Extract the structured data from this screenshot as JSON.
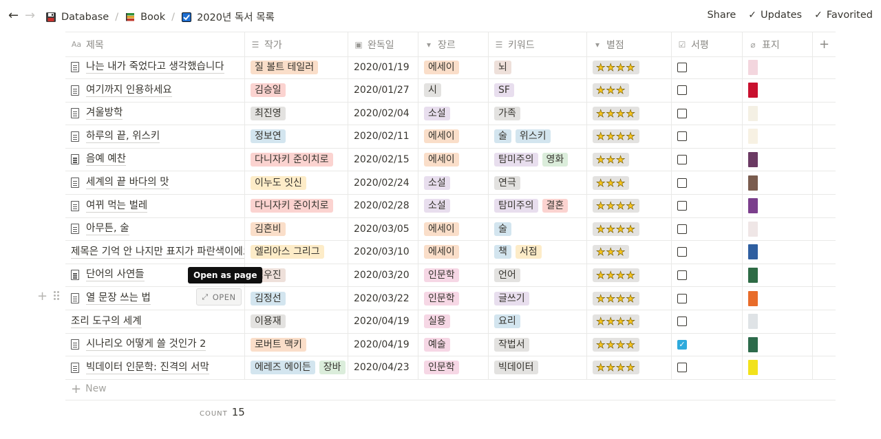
{
  "breadcrumbs": [
    {
      "label": "Database",
      "icon": "floppy-disk-icon"
    },
    {
      "label": "Book",
      "icon": "books-icon"
    },
    {
      "label": "2020년 독서 목록",
      "icon": "checkbox-checked-icon"
    }
  ],
  "actions": {
    "share": "Share",
    "updates": "Updates",
    "favorited": "Favorited"
  },
  "columns": [
    {
      "label": "제목",
      "icon": "Aa"
    },
    {
      "label": "작가",
      "icon": "list-icon"
    },
    {
      "label": "완독일",
      "icon": "calendar-icon"
    },
    {
      "label": "장르",
      "icon": "select-icon"
    },
    {
      "label": "키워드",
      "icon": "list-icon"
    },
    {
      "label": "별점",
      "icon": "select-icon"
    },
    {
      "label": "서평",
      "icon": "checkbox-icon"
    },
    {
      "label": "표지",
      "icon": "paperclip-icon"
    }
  ],
  "rows": [
    {
      "title": "나는 내가 죽었다고 생각했습니다",
      "doc": true,
      "author": [
        {
          "t": "질 볼트 테일러",
          "c": "orange"
        }
      ],
      "date": "2020/01/19",
      "genre": {
        "t": "에세이",
        "c": "orange"
      },
      "keywords": [
        {
          "t": "뇌",
          "c": "brown"
        }
      ],
      "stars": 4,
      "review": false,
      "cover": "#f3d6de"
    },
    {
      "title": "여기까지 인용하세요",
      "doc": true,
      "author": [
        {
          "t": "김승일",
          "c": "red"
        }
      ],
      "date": "2020/01/27",
      "genre": {
        "t": "시",
        "c": "gray"
      },
      "keywords": [
        {
          "t": "SF",
          "c": "purple"
        }
      ],
      "stars": 3,
      "review": false,
      "cover": "#c8102e"
    },
    {
      "title": "겨울방학",
      "doc": true,
      "author": [
        {
          "t": "최진영",
          "c": "gray"
        }
      ],
      "date": "2020/02/04",
      "genre": {
        "t": "소설",
        "c": "purple"
      },
      "keywords": [
        {
          "t": "가족",
          "c": "gray"
        }
      ],
      "stars": 4,
      "review": false,
      "cover": "#f4f0e4"
    },
    {
      "title": "하루의 끝, 위스키",
      "doc": true,
      "author": [
        {
          "t": "정보연",
          "c": "blue"
        }
      ],
      "date": "2020/02/11",
      "genre": {
        "t": "에세이",
        "c": "orange"
      },
      "keywords": [
        {
          "t": "술",
          "c": "blue"
        },
        {
          "t": "위스키",
          "c": "blue"
        }
      ],
      "stars": 4,
      "review": false,
      "cover": "#f7f1e3"
    },
    {
      "title": "음예 예찬",
      "doc": true,
      "author": [
        {
          "t": "다니자키 준이치로",
          "c": "red"
        }
      ],
      "date": "2020/02/15",
      "genre": {
        "t": "에세이",
        "c": "orange"
      },
      "keywords": [
        {
          "t": "탐미주의",
          "c": "purple"
        },
        {
          "t": "영화",
          "c": "green"
        }
      ],
      "stars": 3,
      "review": false,
      "cover": "#6b3a63"
    },
    {
      "title": "세계의 끝 바다의 맛",
      "doc": true,
      "author": [
        {
          "t": "이누도 잇신",
          "c": "yellow"
        }
      ],
      "date": "2020/02/24",
      "genre": {
        "t": "소설",
        "c": "purple"
      },
      "keywords": [
        {
          "t": "연극",
          "c": "gray"
        }
      ],
      "stars": 3,
      "review": false,
      "cover": "#7a5c4e"
    },
    {
      "title": "여뀌 먹는 벌레",
      "doc": true,
      "author": [
        {
          "t": "다니자키 준이치로",
          "c": "red"
        }
      ],
      "date": "2020/02/28",
      "genre": {
        "t": "소설",
        "c": "purple"
      },
      "keywords": [
        {
          "t": "탐미주의",
          "c": "purple"
        },
        {
          "t": "결혼",
          "c": "red"
        }
      ],
      "stars": 4,
      "review": false,
      "cover": "#7b3f8c"
    },
    {
      "title": "아무튼, 술",
      "doc": true,
      "author": [
        {
          "t": "김혼비",
          "c": "orange"
        }
      ],
      "date": "2020/03/05",
      "genre": {
        "t": "에세이",
        "c": "orange"
      },
      "keywords": [
        {
          "t": "술",
          "c": "blue"
        }
      ],
      "stars": 4,
      "review": false,
      "cover": "#efe6e6"
    },
    {
      "title": "제목은 기억 안 나지만 표지가 파란색이에요",
      "doc": false,
      "author": [
        {
          "t": "엘리아스 그리그",
          "c": "yellow"
        }
      ],
      "date": "2020/03/10",
      "genre": {
        "t": "에세이",
        "c": "orange"
      },
      "keywords": [
        {
          "t": "책",
          "c": "blue"
        },
        {
          "t": "서점",
          "c": "yellow"
        }
      ],
      "stars": 3,
      "review": false,
      "cover": "#2f5fa0"
    },
    {
      "title": "단어의 사연들",
      "doc": true,
      "author": [
        {
          "t": "백우진",
          "c": "brown"
        }
      ],
      "date": "2020/03/20",
      "genre": {
        "t": "인문학",
        "c": "pink"
      },
      "keywords": [
        {
          "t": "언어",
          "c": "gray"
        }
      ],
      "stars": 4,
      "review": false,
      "cover": "#2e6b45"
    },
    {
      "title": "열 문장 쓰는 법",
      "doc": true,
      "author": [
        {
          "t": "김정선",
          "c": "blue"
        }
      ],
      "date": "2020/03/22",
      "genre": {
        "t": "인문학",
        "c": "pink"
      },
      "keywords": [
        {
          "t": "글쓰기",
          "c": "purple"
        }
      ],
      "stars": 4,
      "review": false,
      "cover": "#e86c2a"
    },
    {
      "title": "조리 도구의 세계",
      "doc": false,
      "author": [
        {
          "t": "이용재",
          "c": "gray"
        }
      ],
      "date": "2020/04/19",
      "genre": {
        "t": "실용",
        "c": "pink"
      },
      "keywords": [
        {
          "t": "요리",
          "c": "blue"
        }
      ],
      "stars": 4,
      "review": false,
      "cover": "#dfe3e6"
    },
    {
      "title": "시나리오 어떻게 쓸 것인가 2",
      "doc": true,
      "author": [
        {
          "t": "로버트 맥키",
          "c": "orange"
        }
      ],
      "date": "2020/04/19",
      "genre": {
        "t": "예술",
        "c": "pink"
      },
      "keywords": [
        {
          "t": "작법서",
          "c": "gray"
        }
      ],
      "stars": 4,
      "review": true,
      "cover": "#2d6b4b"
    },
    {
      "title": "빅데이터 인문학: 진격의 서막",
      "doc": true,
      "author": [
        {
          "t": "에레즈 에이든",
          "c": "blue"
        },
        {
          "t": "장바",
          "c": "green"
        }
      ],
      "date": "2020/04/23",
      "genre": {
        "t": "인문학",
        "c": "pink"
      },
      "keywords": [
        {
          "t": "빅데이터",
          "c": "gray"
        }
      ],
      "stars": 4,
      "review": false,
      "cover": "#f2e21b"
    }
  ],
  "new_label": "New",
  "count": {
    "label": "COUNT",
    "value": "15"
  },
  "tooltip": "Open as page",
  "open_button": "OPEN",
  "colors": {
    "checkbox_checked": "#2eaadc",
    "border": "#e9e9e7"
  }
}
